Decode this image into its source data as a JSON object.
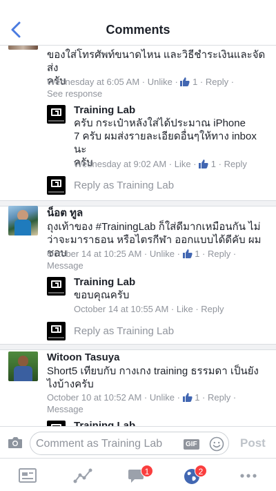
{
  "header": {
    "title": "Comments"
  },
  "comments": {
    "c1": {
      "text_line1": "ของใส่โทรศัพท์ขนาดไหน และวิธีชำระเงินและจัดส่ง",
      "text_line2": "ครับ",
      "time": "Wednesday at 6:05 AM",
      "unlike": "Unlike",
      "likes": "1",
      "reply": "Reply",
      "extra": "See response",
      "page_reply": {
        "name": "Training Lab",
        "text_line1": "ครับ กระเป๋าหลังใส่ได้ประมาณ iPhone",
        "text_line2": "7 ครับ ผมส่งรายละเอียดอื่นๆให้ทาง inbox นะ",
        "text_line3": "ครับ",
        "time": "Wednesday at 9:02 AM",
        "like": "Like",
        "likes": "1",
        "reply": "Reply"
      }
    },
    "c2": {
      "name": "น็อต ทูล",
      "text_line1": "ถุงเท้าของ #TrainingLab ก็ใส่ดีมากเหมือนกัน ไม่",
      "text_line2": "ว่าจะมาราธอน หรือไตรกีฬา ออกแบบได้ดีคับ ผมชอบ",
      "time": "October 14 at 10:25 AM",
      "unlike": "Unlike",
      "likes": "1",
      "reply": "Reply",
      "extra": "Message",
      "page_reply": {
        "name": "Training Lab",
        "text_line1": "ขอบคุณครับ",
        "time": "October 14 at 10:55 AM",
        "like": "Like",
        "reply": "Reply"
      }
    },
    "c3": {
      "name": "Witoon Tasuya",
      "text_line1": "Short5  เทียบกับ กางเกง training ธรรมดา เป็นยัง",
      "text_line2": "ไงบ้างครับ",
      "time": "October 10 at 10:52 AM",
      "unlike": "Unlike",
      "likes": "1",
      "reply": "Reply",
      "extra": "Message",
      "page_reply_peek": "Training Lab"
    }
  },
  "reply_as": "Reply as Training Lab",
  "composer": {
    "placeholder": "Comment as Training Lab",
    "gif": "GIF",
    "post": "Post"
  },
  "tabbar": {
    "notifications_badge": "1",
    "globe_badge": "2"
  },
  "colors": {
    "accent": "#4267b2",
    "meta": "#90949c",
    "badge": "#fa3e3e"
  }
}
